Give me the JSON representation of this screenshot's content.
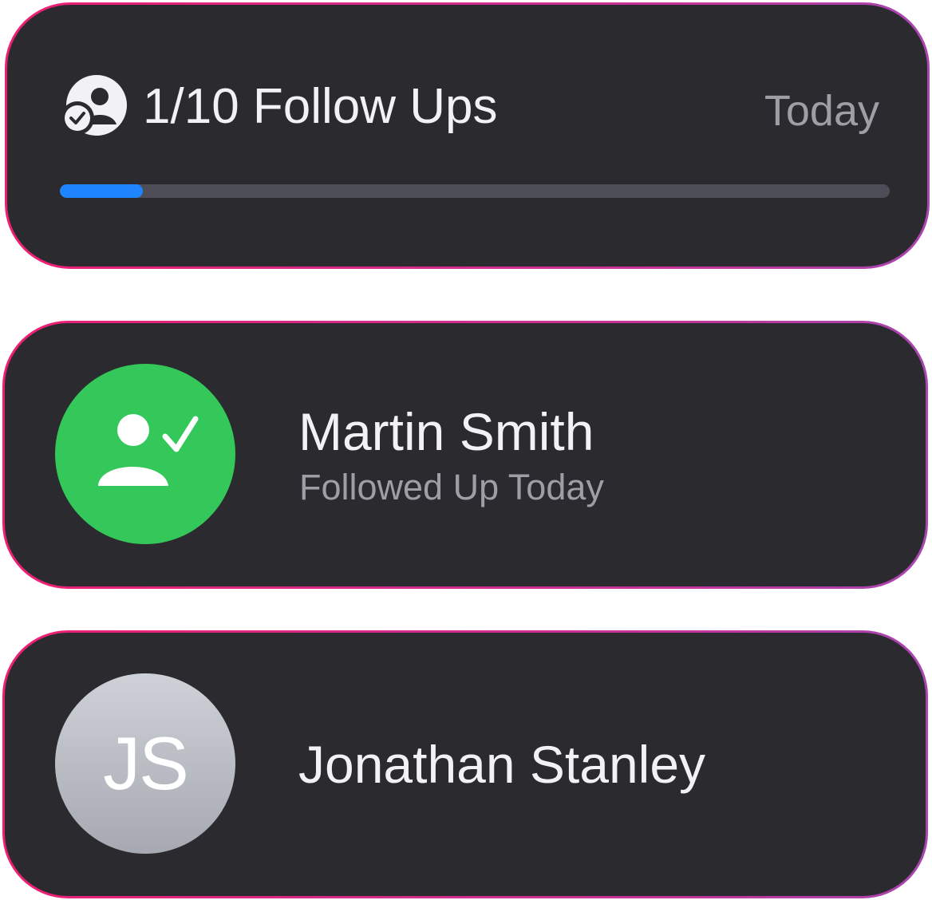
{
  "summary": {
    "title": "1/10 Follow Ups",
    "date_label": "Today",
    "progress": {
      "completed": 1,
      "total": 10,
      "fraction": 0.1
    },
    "icon": "person-crop-circle-badge-checkmark-icon"
  },
  "contacts": [
    {
      "name": "Martin Smith",
      "status": "Followed Up Today",
      "avatar_icon": "person-checkmark-icon",
      "avatar_color": "#34c759"
    },
    {
      "name": "Jonathan Stanley",
      "initials": "JS",
      "avatar_color": "#b9bbc2"
    }
  ],
  "colors": {
    "card_background": "#2a2a2f",
    "border_gradient": [
      "#ee1f72",
      "#a845b0"
    ],
    "progress_fill": "#1e84ff",
    "progress_track": "#4d4d57",
    "primary_text": "#f2f2f4",
    "secondary_text": "#9e9ea6"
  }
}
